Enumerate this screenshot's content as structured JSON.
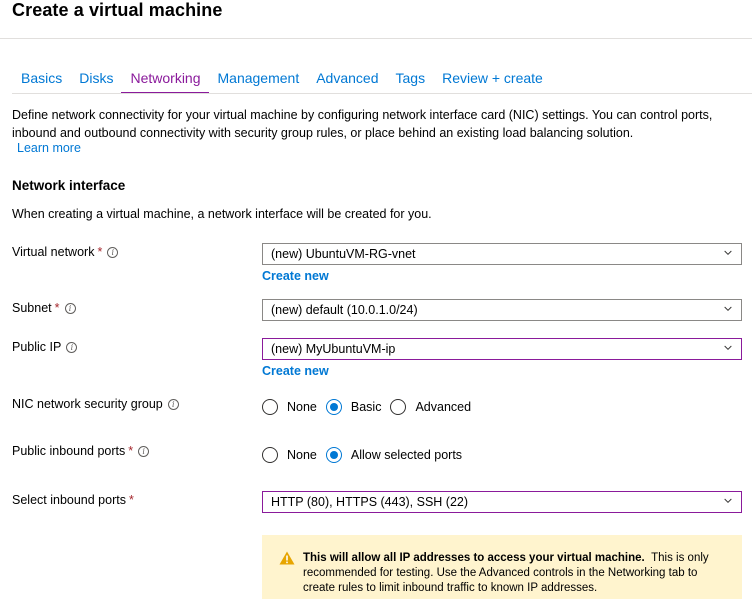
{
  "header": {
    "title": "Create a virtual machine"
  },
  "tabs": [
    {
      "label": "Basics"
    },
    {
      "label": "Disks"
    },
    {
      "label": "Networking"
    },
    {
      "label": "Management"
    },
    {
      "label": "Advanced"
    },
    {
      "label": "Tags"
    },
    {
      "label": "Review + create"
    }
  ],
  "active_tab": "Networking",
  "description": "Define network connectivity for your virtual machine by configuring network interface card (NIC) settings. You can control ports, inbound and outbound connectivity with security group rules, or place behind an existing load balancing solution.",
  "learn_more": "Learn more",
  "section": {
    "title": "Network interface",
    "description": "When creating a virtual machine, a network interface will be created for you."
  },
  "fields": {
    "virtual_network": {
      "label": "Virtual network",
      "required": "*",
      "value": "(new) UbuntuVM-RG-vnet",
      "create_new": "Create new"
    },
    "subnet": {
      "label": "Subnet",
      "required": "*",
      "value": "(new) default (10.0.1.0/24)"
    },
    "public_ip": {
      "label": "Public IP",
      "value": "(new) MyUbuntuVM-ip",
      "create_new": "Create new"
    },
    "nic_nsg": {
      "label": "NIC network security group",
      "options": [
        "None",
        "Basic",
        "Advanced"
      ],
      "selected": "Basic"
    },
    "public_inbound_ports": {
      "label": "Public inbound ports",
      "required": "*",
      "options": [
        "None",
        "Allow selected ports"
      ],
      "selected": "Allow selected ports"
    },
    "select_inbound_ports": {
      "label": "Select inbound ports",
      "required": "*",
      "value": "HTTP (80), HTTPS (443), SSH (22)"
    }
  },
  "warning": {
    "bold": "This will allow all IP addresses to access your virtual machine.",
    "text": "This is only recommended for testing.  Use the Advanced controls in the Networking tab to create rules to limit inbound traffic to known IP addresses.",
    "icon": "warning-triangle-icon"
  },
  "colors": {
    "accent": "#0078d4",
    "active_tab": "#8a1a9b",
    "warning_bg": "#fff4ce",
    "required": "#a4262c"
  }
}
